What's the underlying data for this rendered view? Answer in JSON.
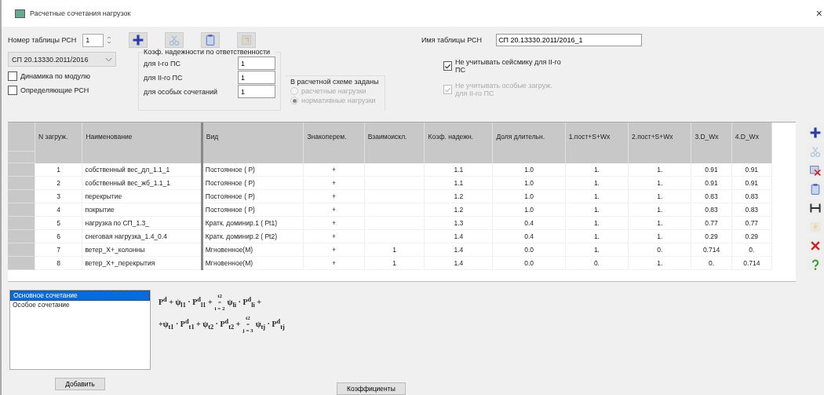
{
  "window": {
    "title": "Расчетные сочетания нагрузок",
    "close": "×"
  },
  "table_number": {
    "label": "Номер таблицы РСН",
    "value": "1"
  },
  "toolbar": [
    {
      "kind": "add",
      "disabled": false
    },
    {
      "kind": "cut",
      "disabled": true
    },
    {
      "kind": "paste",
      "disabled": false
    },
    {
      "kind": "export",
      "disabled": true
    }
  ],
  "table_name": {
    "label": "Имя таблицы РСН",
    "value": "СП 20.13330.2011/2016_1"
  },
  "norm": {
    "value": "СП 20.13330.2011/2016"
  },
  "options": [
    {
      "label": "Динамика по модулю",
      "checked": false
    },
    {
      "label": "Определяющие РСН",
      "checked": false
    }
  ],
  "reliability": {
    "title": "Коэф. надежности по ответственности",
    "fields": [
      {
        "label": "для I-го ПС",
        "value": "1"
      },
      {
        "label": "для II-го ПС",
        "value": "1"
      },
      {
        "label": "для особых сочетаний",
        "value": "1"
      }
    ]
  },
  "scheme": {
    "title": "В расчетной схеме заданы",
    "options": [
      {
        "label": "расчетные нагрузки",
        "selected": false,
        "disabled": true
      },
      {
        "label": "нормативные нагрузки",
        "selected": true,
        "disabled": true
      }
    ]
  },
  "exclusions": [
    {
      "label": "Не учитывать сейсмику для II-го ПС",
      "checked": true,
      "disabled": false
    },
    {
      "label": "Не учитывать особые загруж. для II-го ПС",
      "checked": true,
      "disabled": true
    }
  ],
  "table": {
    "columns": [
      "N загруж.",
      "Наименование",
      "Вид",
      "Знакоперем.",
      "Взаимоискл.",
      "Коэф. надежн.",
      "Доля длительн.",
      "1.пост+S+Wx",
      "2.пост+S+Wx",
      "3.D_Wx",
      "4.D_Wx"
    ],
    "rows": [
      [
        "1",
        "собственный вес_дл_1.1_1",
        "Постоянное ( P)",
        "+",
        "",
        "1.1",
        "1.0",
        "1.",
        "1.",
        "0.91",
        "0.91"
      ],
      [
        "2",
        "собственный вес_жб_1.1_1",
        "Постоянное ( P)",
        "+",
        "",
        "1.1",
        "1.0",
        "1.",
        "1.",
        "0.91",
        "0.91"
      ],
      [
        "3",
        "перекрытие",
        "Постоянное ( P)",
        "+",
        "",
        "1.2",
        "1.0",
        "1.",
        "1.",
        "0.83",
        "0.83"
      ],
      [
        "4",
        "покрытие",
        "Постоянное ( P)",
        "+",
        "",
        "1.2",
        "1.0",
        "1.",
        "1.",
        "0.83",
        "0.83"
      ],
      [
        "5",
        "нагрузка по СП_1.3_",
        "Кратк. доминир.1 ( Pt1)",
        "+",
        "",
        "1.3",
        "0.4",
        "1.",
        "1.",
        "0.77",
        "0.77"
      ],
      [
        "6",
        "снеговая нагрузка_1.4_0.4",
        "Кратк. доминир.2 ( Pt2)",
        "+",
        "",
        "1.4",
        "0.4",
        "1.",
        "1.",
        "0.29",
        "0.29"
      ],
      [
        "7",
        "ветер_X+_колонны",
        "Мгновенное(M)",
        "+",
        "1",
        "1.4",
        "0.0",
        "1.",
        "0.",
        "0.714",
        "0."
      ],
      [
        "8",
        "ветер_X+_перекрытия",
        "Мгновенное(M)",
        "+",
        "1",
        "1.4",
        "0.0",
        "0.",
        "1.",
        "0.",
        "0.714"
      ]
    ]
  },
  "side_toolbar": [
    {
      "kind": "add",
      "disabled": false
    },
    {
      "kind": "cut",
      "disabled": true
    },
    {
      "kind": "delete-row",
      "disabled": false
    },
    {
      "kind": "paste",
      "disabled": false
    },
    {
      "kind": "columns",
      "disabled": false
    },
    {
      "kind": "lightning",
      "disabled": true
    },
    {
      "kind": "delete",
      "disabled": false
    },
    {
      "kind": "help",
      "disabled": false
    }
  ],
  "combinations": [
    {
      "label": "Основное сочетание",
      "selected": true
    },
    {
      "label": "Особое сочетание",
      "selected": false
    }
  ],
  "formula": [
    [
      {
        "kind": "text",
        "text": "P$^{d}$ + ψ$_{l1}$ · P$^{d}$$_{l1}$ +"
      },
      {
        "kind": "sum",
        "upper": "t2",
        "sign": "=",
        "lower": "i = 2"
      },
      {
        "kind": "text",
        "text": "ψ$_{li}$ · P$^{d}$$_{li}$ +"
      }
    ],
    [
      {
        "kind": "text",
        "text": "+ψ$_{t1}$ · P$^{d}$$_{t1}$ + ψ$_{t2}$ · P$^{d}$$_{t2}$ +"
      },
      {
        "kind": "sum",
        "upper": "t2",
        "sign": "=",
        "lower": "j = 3"
      },
      {
        "kind": "text",
        "text": "ψ$_{tj}$ · P$^{d}$$_{tj}$"
      }
    ]
  ],
  "buttons": {
    "add": "Добавить",
    "coefficients": "Коэффициенты"
  }
}
